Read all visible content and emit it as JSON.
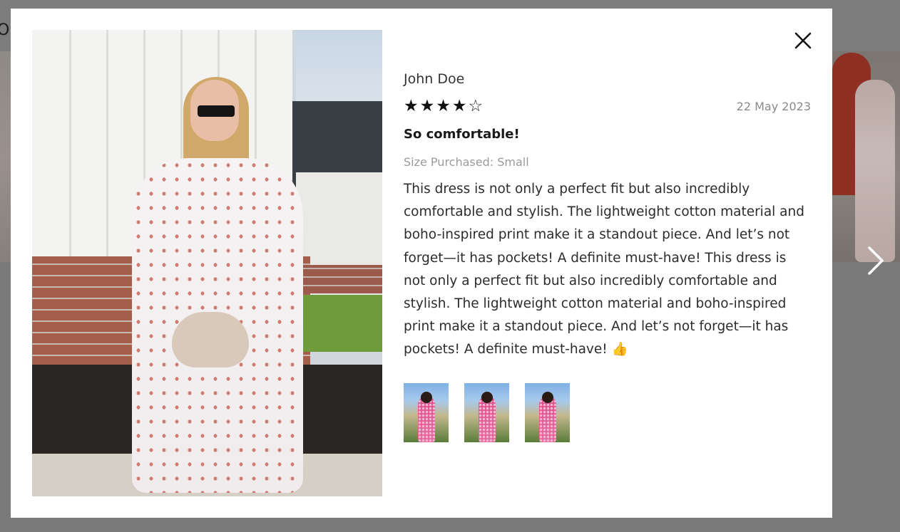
{
  "background": {
    "header_fragment": "OS"
  },
  "icons": {
    "close": "close-icon",
    "next": "chevron-right-icon",
    "star_filled": "★",
    "star_empty": "☆"
  },
  "review": {
    "author": "John Doe",
    "rating": 4,
    "rating_max": 5,
    "stars": [
      "★",
      "★",
      "★",
      "★",
      "☆"
    ],
    "date": "22 May 2023",
    "title": "So comfortable!",
    "size_label": "Size Purchased:",
    "size_value": "Small",
    "body": "This dress is not only a perfect fit but also incredibly comfortable and stylish. The lightweight cotton material and boho-inspired print make it a standout piece. And let’s not forget—it has pockets! A definite must-have! This dress is not only a perfect fit but also incredibly comfortable and stylish. The lightweight cotton material and boho-inspired print make it a standout piece. And let’s not forget—it has pockets! A definite must-have! 👍",
    "thumbnail_count": 3
  },
  "colors": {
    "overlay": "#7a7a7a",
    "modal_bg": "#ffffff",
    "text_primary": "#2c2c2c",
    "text_muted": "#8a8a8a"
  }
}
